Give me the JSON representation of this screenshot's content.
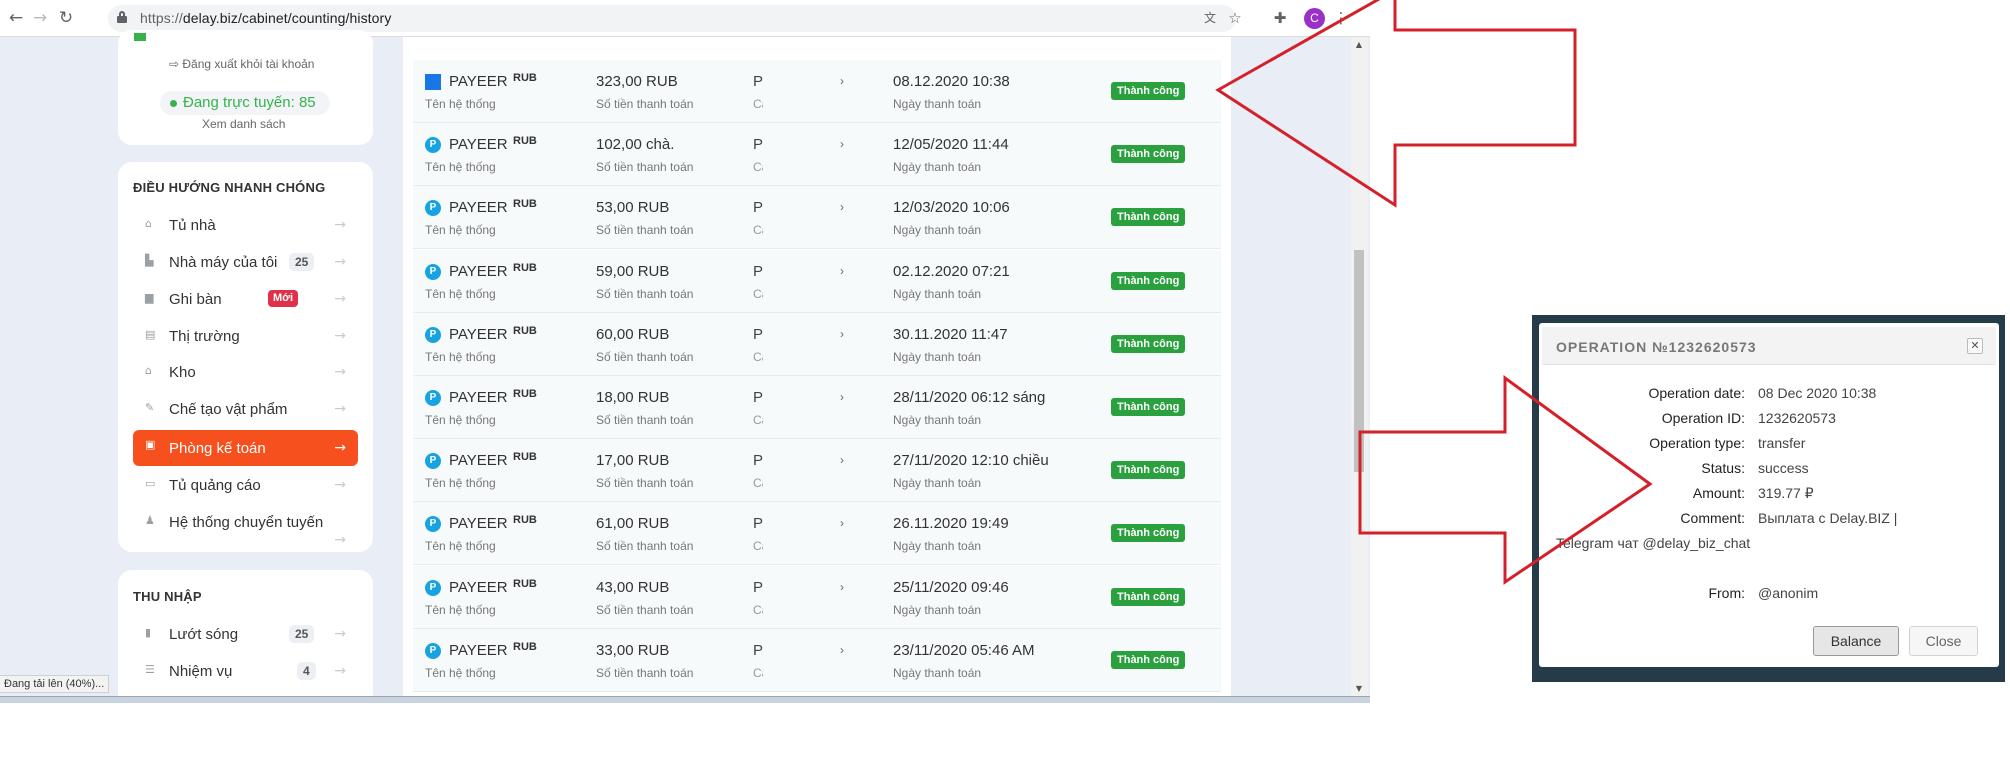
{
  "browser": {
    "url_scheme": "https://",
    "url_rest": "delay.biz/cabinet/counting/history",
    "avatar_letter": "C"
  },
  "sidebar": {
    "logout_label": "⇨ Đăng xuất khỏi tài khoản",
    "online_label": "Đang trực tuyến: ",
    "online_count": "85",
    "see_list": "Xem danh sách",
    "quick_nav_title": "ĐIỀU HƯỚNG NHANH CHÓNG",
    "items": [
      {
        "label": "Tủ nhà",
        "icon": "home-icon"
      },
      {
        "label": "Nhà máy của tôi",
        "icon": "factory-icon",
        "count": "25"
      },
      {
        "label": "Ghi bàn",
        "icon": "score-icon",
        "badge": "Mới"
      },
      {
        "label": "Thị trường",
        "icon": "market-icon"
      },
      {
        "label": "Kho",
        "icon": "warehouse-icon"
      },
      {
        "label": "Chế tạo vật phẩm",
        "icon": "craft-icon"
      },
      {
        "label": "Phòng kế toán",
        "icon": "accounting-icon",
        "active": true
      },
      {
        "label": "Tủ quảng cáo",
        "icon": "ads-icon"
      },
      {
        "label": "Hệ thống chuyển tuyến",
        "icon": "referral-icon"
      }
    ],
    "income_title": "THU NHẬP",
    "income_items": [
      {
        "label": "Lướt sóng",
        "count": "25"
      },
      {
        "label": "Nhiệm vụ",
        "count": "4"
      }
    ]
  },
  "table": {
    "system_sub": "Tên hệ thống",
    "amount_sub": "Số tiền thanh toán",
    "date_sub": "Ngày thanh toán",
    "p_col": "P",
    "p_sub": "Cá",
    "rows": [
      {
        "system": "PAYEER",
        "currency": "RUB",
        "amount": "323,00 RUB",
        "date": "08.12.2020 10:38",
        "status": "Thành công"
      },
      {
        "system": "PAYEER",
        "currency": "RUB",
        "amount": "102,00 chà.",
        "date": "12/05/2020 11:44",
        "status": "Thành công"
      },
      {
        "system": "PAYEER",
        "currency": "RUB",
        "amount": "53,00 RUB",
        "date": "12/03/2020 10:06",
        "status": "Thành công"
      },
      {
        "system": "PAYEER",
        "currency": "RUB",
        "amount": "59,00 RUB",
        "date": "02.12.2020 07:21",
        "status": "Thành công"
      },
      {
        "system": "PAYEER",
        "currency": "RUB",
        "amount": "60,00 RUB",
        "date": "30.11.2020 11:47",
        "status": "Thành công"
      },
      {
        "system": "PAYEER",
        "currency": "RUB",
        "amount": "18,00 RUB",
        "date": "28/11/2020 06:12 sáng",
        "status": "Thành công"
      },
      {
        "system": "PAYEER",
        "currency": "RUB",
        "amount": "17,00 RUB",
        "date": "27/11/2020 12:10 chiều",
        "status": "Thành công"
      },
      {
        "system": "PAYEER",
        "currency": "RUB",
        "amount": "61,00 RUB",
        "date": "26.11.2020 19:49",
        "status": "Thành công"
      },
      {
        "system": "PAYEER",
        "currency": "RUB",
        "amount": "43,00 RUB",
        "date": "25/11/2020 09:46",
        "status": "Thành công"
      },
      {
        "system": "PAYEER",
        "currency": "RUB",
        "amount": "33,00 RUB",
        "date": "23/11/2020 05:46 AM",
        "status": "Thành công"
      }
    ]
  },
  "statusbar": "Đang tải lên (40%)...",
  "dialog": {
    "title": "OPERATION №1232620573",
    "fields": [
      {
        "label": "Operation date:",
        "value": "08 Dec 2020 10:38"
      },
      {
        "label": "Operation ID:",
        "value": "1232620573"
      },
      {
        "label": "Operation type:",
        "value": "transfer"
      },
      {
        "label": "Status:",
        "value": "success"
      },
      {
        "label": "Amount:",
        "value": "319.77 ₽"
      },
      {
        "label": "Comment:",
        "value": "Выплата с Delay.BIZ |"
      }
    ],
    "comment_cont": "Telegram чат @delay_biz_chat",
    "from_label": "From:",
    "from_value": "@anonim",
    "balance_btn": "Balance",
    "close_btn": "Close"
  },
  "colors": {
    "accent": "#f5501e",
    "success": "#2aa13e",
    "payeer": "#17a3e0",
    "annotation": "#d4202a"
  }
}
